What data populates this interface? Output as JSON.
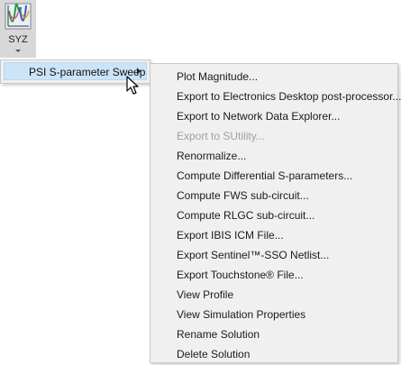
{
  "toolbar": {
    "syz_button_label": "SYZ"
  },
  "menu": {
    "top_item_label": "PSI S-parameter Sweep",
    "submenu_items": [
      {
        "label": "Plot Magnitude...",
        "enabled": true
      },
      {
        "label": "Export to Electronics Desktop post-processor...",
        "enabled": true
      },
      {
        "label": "Export to Network Data Explorer...",
        "enabled": true
      },
      {
        "label": "Export to SUtility...",
        "enabled": false
      },
      {
        "label": "Renormalize...",
        "enabled": true
      },
      {
        "label": "Compute Differential S-parameters...",
        "enabled": true
      },
      {
        "label": "Compute FWS sub-circuit...",
        "enabled": true
      },
      {
        "label": "Compute RLGC sub-circuit...",
        "enabled": true
      },
      {
        "label": "Export IBIS ICM File...",
        "enabled": true
      },
      {
        "label": "Export Sentinel™-SSO Netlist...",
        "enabled": true
      },
      {
        "label": "Export Touchstone® File...",
        "enabled": true
      },
      {
        "label": "View Profile",
        "enabled": true
      },
      {
        "label": "View Simulation Properties",
        "enabled": true
      },
      {
        "label": "Rename Solution",
        "enabled": true
      },
      {
        "label": "Delete Solution",
        "enabled": true
      }
    ]
  },
  "icons": {
    "syz_tool": "syz-plot-icon",
    "submenu_arrow": "chevron-right-icon",
    "cursor": "mouse-pointer-icon"
  },
  "colors": {
    "menu_background": "#f0f0f0",
    "hover_highlight": "#cce4f7",
    "disabled_text": "#a0a0a0",
    "tool_background": "#d8d8d8"
  }
}
